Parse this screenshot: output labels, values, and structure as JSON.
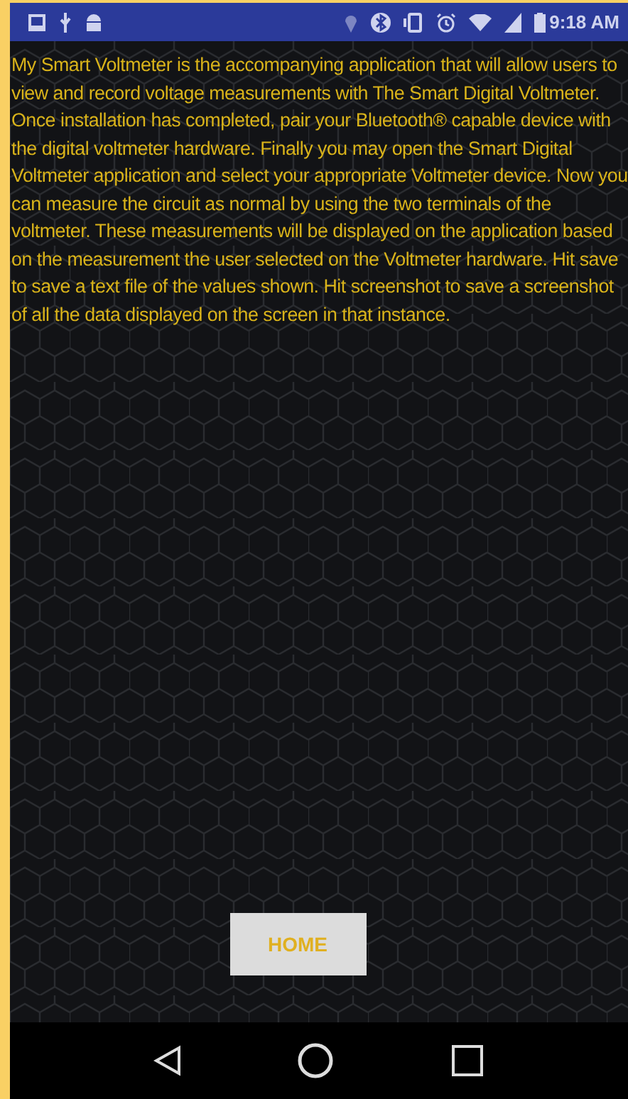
{
  "status_bar": {
    "time": "9:18 AM"
  },
  "description": "My Smart Voltmeter is the accompanying application that will allow users to view and record voltage measurements with The Smart Digital Voltmeter. Once installation has completed, pair your Bluetooth® capable device with the digital voltmeter hardware. Finally you may open the Smart Digital Voltmeter application and select your appropriate Voltmeter device. Now you can measure the circuit as normal by using the two terminals of the voltmeter. These measurements will be displayed on the application based on the measurement the user selected on the Voltmeter hardware. Hit save to save a text file of the values shown. Hit screenshot to save a screenshot of all the data displayed on the screen in that instance.",
  "home_button": "HOME"
}
